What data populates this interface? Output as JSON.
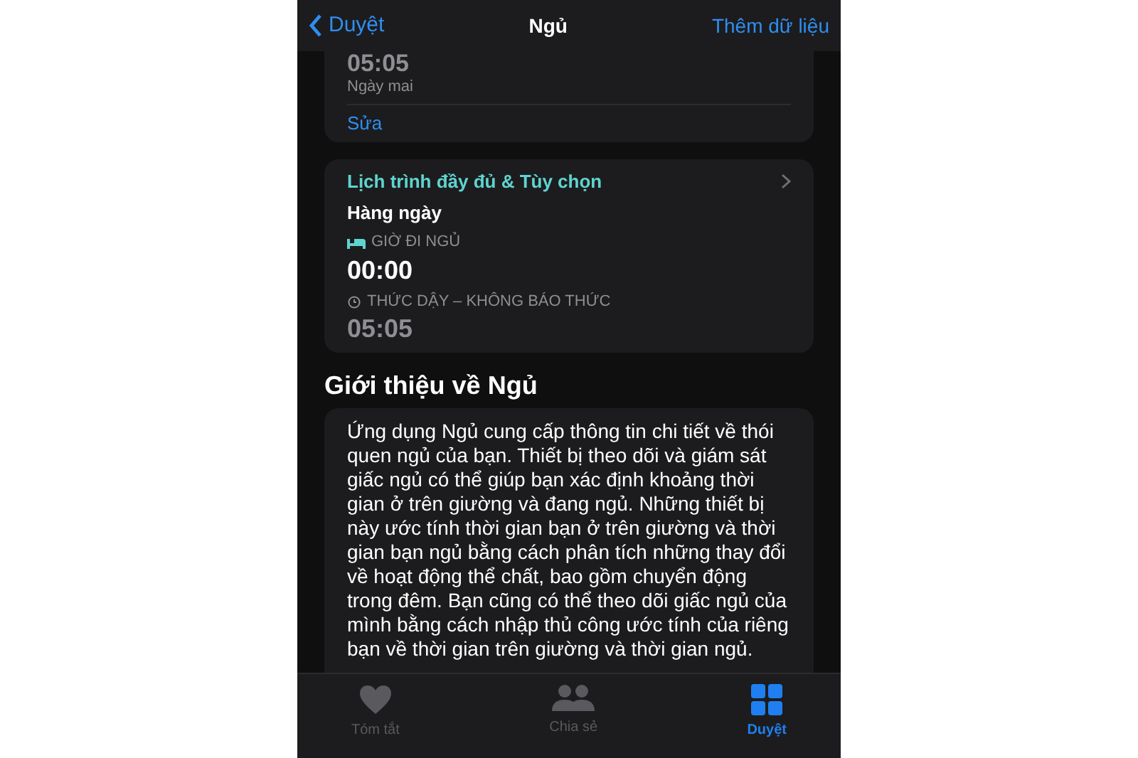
{
  "nav": {
    "back": "Duyệt",
    "title": "Ngủ",
    "action": "Thêm dữ liệu"
  },
  "top_card": {
    "time": "05:05",
    "day": "Ngày mai",
    "edit": "Sửa"
  },
  "schedule_card": {
    "title": "Lịch trình đầy đủ & Tùy chọn",
    "repeat": "Hàng ngày",
    "bedtime_label": "GIỜ ĐI NGỦ",
    "bedtime": "00:00",
    "wake_label": "THỨC DẬY – KHÔNG BÁO THỨC",
    "wake": "05:05"
  },
  "about": {
    "heading": "Giới thiệu về Ngủ",
    "text": "Ứng dụng Ngủ cung cấp thông tin chi tiết về thói quen ngủ của bạn. Thiết bị theo dõi và giám sát giấc ngủ có thể giúp bạn xác định khoảng thời gian ở trên giường và đang ngủ. Những thiết bị này ước tính thời gian bạn ở trên giường và thời gian bạn ngủ bằng cách phân tích những thay đổi về hoạt động thể chất, bao gồm chuyển động trong đêm. Bạn cũng có thể theo dõi giấc ngủ của mình bằng cách nhập thủ công ước tính của riêng bạn về thời gian trên giường và thời gian ngủ."
  },
  "tab_bar": [
    {
      "kind": "heart",
      "label": "Tóm tắt",
      "selected": false
    },
    {
      "kind": "people",
      "label": "Chia sẻ",
      "selected": false
    },
    {
      "kind": "grid",
      "label": "Duyệt",
      "selected": true
    }
  ]
}
